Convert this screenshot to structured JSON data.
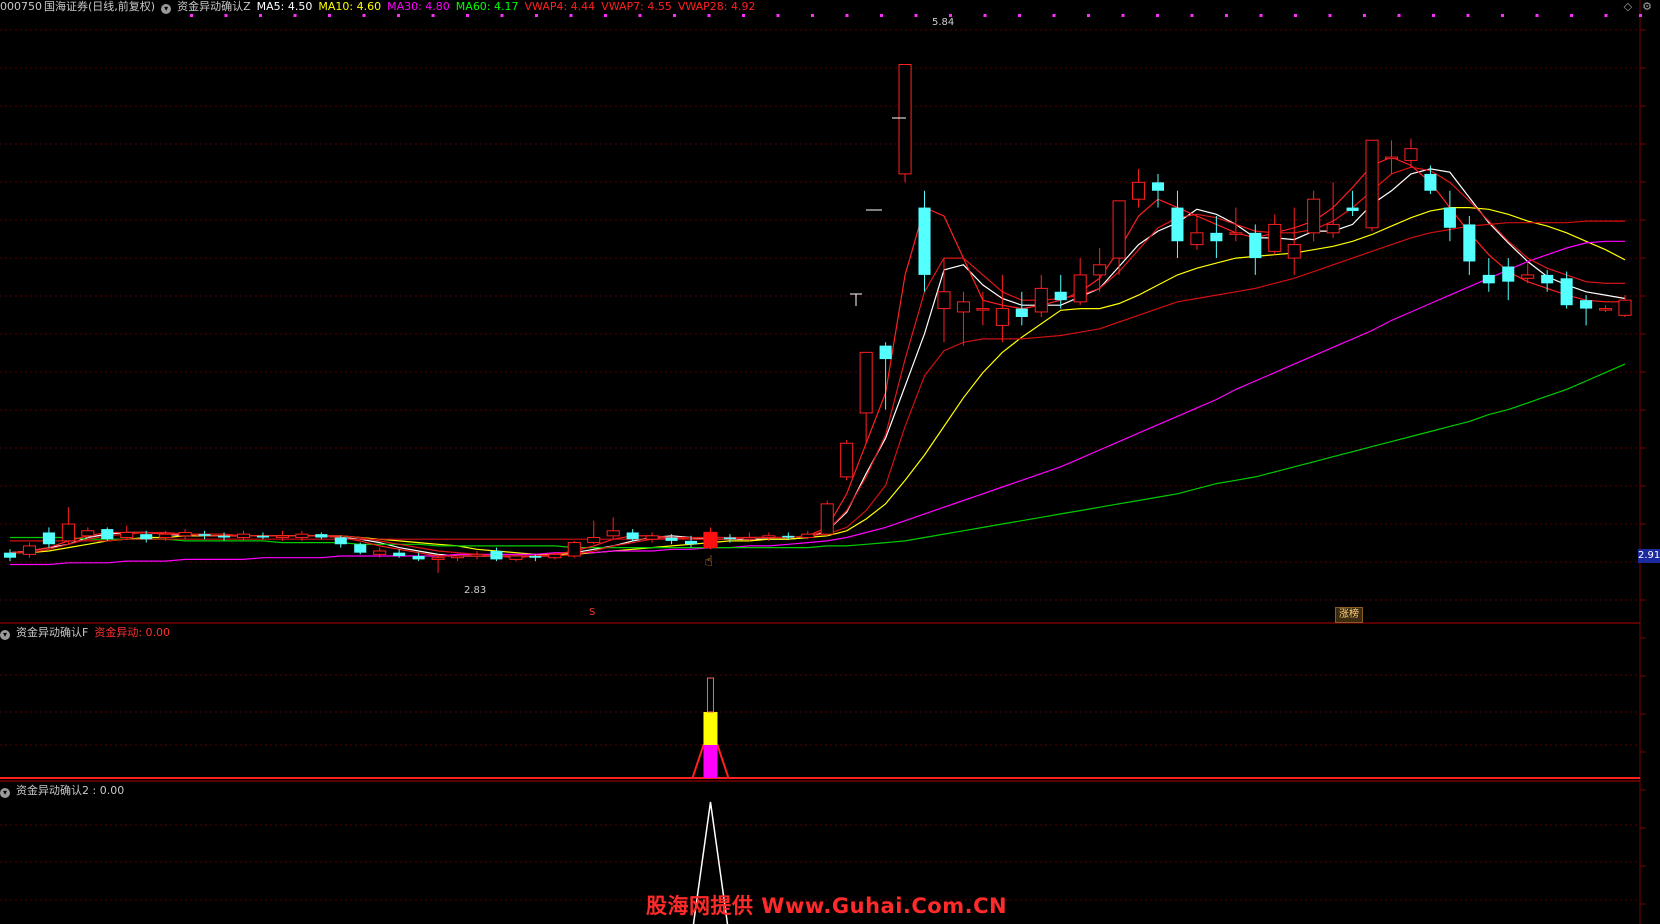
{
  "header_main": {
    "symbol": "000750",
    "name": "国海证券(日线,前复权)",
    "indicator": "资金异动确认Z",
    "ma": [
      {
        "label": "MA5: 4.50",
        "color": "#ffffff"
      },
      {
        "label": "MA10: 4.60",
        "color": "#ffff00"
      },
      {
        "label": "MA30: 4.80",
        "color": "#ff00ff"
      },
      {
        "label": "MA60: 4.17",
        "color": "#00ff00"
      },
      {
        "label": "VWAP4: 4.44",
        "color": "#ff2020"
      },
      {
        "label": "VWAP7: 4.55",
        "color": "#ff2020"
      },
      {
        "label": "VWAP28: 4.92",
        "color": "#ff2020"
      }
    ]
  },
  "header_panel2": {
    "name": "资金异动确认F",
    "value": "资金异动: 0.00"
  },
  "header_panel3": {
    "name": "资金异动确认2 : 0.00"
  },
  "labels": {
    "high": "5.84",
    "low": "2.83",
    "last_price": "2.91",
    "badge": "涨榜",
    "s_mark": "S"
  },
  "watermark": "股海网提供 Www.Guhai.Com.CN",
  "icons": [
    "diamond-icon",
    "settings-icon"
  ],
  "colors": {
    "up": "#ff2020",
    "down": "#54ffff",
    "ma5": "#ffffff",
    "ma10": "#ffff00",
    "ma30": "#ff00ff",
    "ma60": "#00cc00",
    "grid": "#5a0000"
  },
  "chart_data": {
    "type": "candlestick",
    "y_range": [
      2.55,
      6.15
    ],
    "candles": [
      [
        2.95,
        2.92,
        2.97,
        2.9
      ],
      [
        2.94,
        2.99,
        3.01,
        2.92
      ],
      [
        3.07,
        3.0,
        3.1,
        2.98
      ],
      [
        3.02,
        3.12,
        3.22,
        3.0
      ],
      [
        3.05,
        3.08,
        3.1,
        3.03
      ],
      [
        3.09,
        3.03,
        3.1,
        3.02
      ],
      [
        3.04,
        3.07,
        3.11,
        3.03
      ],
      [
        3.06,
        3.03,
        3.08,
        3.01
      ],
      [
        3.04,
        3.06,
        3.08,
        3.02
      ],
      [
        3.05,
        3.07,
        3.09,
        3.03
      ],
      [
        3.06,
        3.05,
        3.08,
        3.03
      ],
      [
        3.05,
        3.04,
        3.07,
        3.02
      ],
      [
        3.04,
        3.06,
        3.08,
        3.02
      ],
      [
        3.05,
        3.04,
        3.07,
        3.03
      ],
      [
        3.04,
        3.05,
        3.08,
        3.02
      ],
      [
        3.04,
        3.06,
        3.08,
        3.02
      ],
      [
        3.06,
        3.04,
        3.07,
        3.03
      ],
      [
        3.04,
        3.0,
        3.05,
        2.98
      ],
      [
        3.0,
        2.95,
        3.01,
        2.94
      ],
      [
        2.94,
        2.96,
        2.98,
        2.92
      ],
      [
        2.95,
        2.93,
        2.97,
        2.92
      ],
      [
        2.93,
        2.91,
        2.95,
        2.9
      ],
      [
        2.91,
        2.92,
        2.94,
        2.83
      ],
      [
        2.92,
        2.93,
        2.94,
        2.9
      ],
      [
        2.93,
        2.94,
        2.96,
        2.91
      ],
      [
        2.96,
        2.91,
        2.98,
        2.9
      ],
      [
        2.91,
        2.93,
        2.94,
        2.9
      ],
      [
        2.93,
        2.92,
        2.94,
        2.9
      ],
      [
        2.92,
        2.94,
        2.95,
        2.91
      ],
      [
        2.93,
        3.01,
        3.02,
        2.92
      ],
      [
        3.01,
        3.04,
        3.14,
        3.0
      ],
      [
        3.05,
        3.08,
        3.16,
        3.03
      ],
      [
        3.07,
        3.03,
        3.09,
        3.02
      ],
      [
        3.03,
        3.05,
        3.07,
        3.01
      ],
      [
        3.04,
        3.02,
        3.06,
        3.0
      ],
      [
        3.02,
        3.0,
        3.05,
        2.98
      ],
      [
        2.98,
        3.04,
        3.1,
        2.97
      ],
      [
        3.04,
        3.03,
        3.06,
        3.01
      ],
      [
        3.03,
        3.04,
        3.07,
        3.02
      ],
      [
        3.04,
        3.05,
        3.07,
        3.02
      ],
      [
        3.05,
        3.04,
        3.07,
        3.03
      ],
      [
        3.04,
        3.06,
        3.08,
        3.03
      ],
      [
        3.06,
        3.24,
        3.26,
        3.05
      ],
      [
        3.4,
        3.6,
        3.62,
        3.38
      ],
      [
        3.78,
        4.14,
        4.14,
        3.6
      ],
      [
        4.18,
        4.1,
        4.2,
        3.8
      ],
      [
        5.2,
        5.85,
        5.85,
        5.15
      ],
      [
        5.0,
        4.6,
        5.1,
        4.5
      ],
      [
        4.4,
        4.5,
        4.7,
        4.2
      ],
      [
        4.38,
        4.44,
        4.5,
        4.18
      ],
      [
        4.4,
        4.4,
        4.5,
        4.3
      ],
      [
        4.3,
        4.4,
        4.6,
        4.2
      ],
      [
        4.4,
        4.35,
        4.5,
        4.3
      ],
      [
        4.38,
        4.52,
        4.6,
        4.35
      ],
      [
        4.5,
        4.45,
        4.6,
        4.4
      ],
      [
        4.44,
        4.6,
        4.7,
        4.42
      ],
      [
        4.6,
        4.66,
        4.76,
        4.5
      ],
      [
        4.7,
        5.04,
        5.04,
        4.6
      ],
      [
        5.05,
        5.15,
        5.23,
        5.0
      ],
      [
        5.15,
        5.1,
        5.2,
        5.0
      ],
      [
        5.0,
        4.8,
        5.1,
        4.7
      ],
      [
        4.78,
        4.85,
        4.95,
        4.75
      ],
      [
        4.85,
        4.8,
        4.95,
        4.7
      ],
      [
        4.85,
        4.85,
        5.0,
        4.8
      ],
      [
        4.85,
        4.7,
        4.9,
        4.6
      ],
      [
        4.74,
        4.9,
        4.96,
        4.72
      ],
      [
        4.7,
        4.78,
        5.0,
        4.6
      ],
      [
        4.85,
        5.05,
        5.1,
        4.8
      ],
      [
        4.85,
        4.9,
        5.15,
        4.82
      ],
      [
        5.0,
        4.98,
        5.1,
        4.95
      ],
      [
        4.88,
        5.4,
        5.4,
        4.86
      ],
      [
        5.3,
        5.3,
        5.4,
        5.2
      ],
      [
        5.28,
        5.35,
        5.41,
        5.24
      ],
      [
        5.2,
        5.1,
        5.25,
        5.08
      ],
      [
        5.0,
        4.88,
        5.1,
        4.8
      ],
      [
        4.9,
        4.68,
        4.95,
        4.6
      ],
      [
        4.6,
        4.55,
        4.7,
        4.5
      ],
      [
        4.65,
        4.56,
        4.7,
        4.45
      ],
      [
        4.58,
        4.6,
        4.68,
        4.55
      ],
      [
        4.6,
        4.55,
        4.63,
        4.5
      ],
      [
        4.58,
        4.42,
        4.62,
        4.4
      ],
      [
        4.45,
        4.4,
        4.48,
        4.3
      ],
      [
        4.4,
        4.4,
        4.42,
        4.38
      ],
      [
        4.36,
        4.45,
        4.48,
        4.35
      ]
    ],
    "series": [
      {
        "name": "MA5",
        "values": [
          2.95,
          2.96,
          2.98,
          3.0,
          3.04,
          3.06,
          3.07,
          3.07,
          3.06,
          3.05,
          3.05,
          3.05,
          3.05,
          3.05,
          3.05,
          3.05,
          3.05,
          3.04,
          3.03,
          3.01,
          2.98,
          2.96,
          2.94,
          2.93,
          2.93,
          2.93,
          2.93,
          2.93,
          2.93,
          2.95,
          2.97,
          2.99,
          3.02,
          3.04,
          3.05,
          3.04,
          3.03,
          3.03,
          3.03,
          3.03,
          3.03,
          3.04,
          3.08,
          3.19,
          3.42,
          3.63,
          3.94,
          4.25,
          4.63,
          4.66,
          4.54,
          4.46,
          4.42,
          4.42,
          4.42,
          4.47,
          4.52,
          4.65,
          4.78,
          4.86,
          4.91,
          4.99,
          4.96,
          4.9,
          4.82,
          4.82,
          4.81,
          4.86,
          4.86,
          4.9,
          5.02,
          5.1,
          5.2,
          5.23,
          5.21,
          5.06,
          4.91,
          4.79,
          4.68,
          4.59,
          4.54,
          4.5,
          4.48,
          4.46
        ]
      },
      {
        "name": "MA10",
        "values": [
          2.95,
          2.95,
          2.96,
          2.98,
          3.0,
          3.02,
          3.03,
          3.04,
          3.04,
          3.05,
          3.05,
          3.05,
          3.05,
          3.05,
          3.05,
          3.05,
          3.05,
          3.05,
          3.04,
          3.03,
          3.02,
          3.01,
          3.0,
          2.99,
          2.97,
          2.96,
          2.95,
          2.94,
          2.94,
          2.94,
          2.95,
          2.96,
          2.97,
          2.98,
          2.99,
          3.0,
          3.01,
          3.02,
          3.02,
          3.03,
          3.03,
          3.04,
          3.05,
          3.08,
          3.15,
          3.24,
          3.38,
          3.53,
          3.7,
          3.87,
          4.02,
          4.14,
          4.23,
          4.31,
          4.39,
          4.4,
          4.4,
          4.43,
          4.48,
          4.54,
          4.6,
          4.64,
          4.67,
          4.7,
          4.71,
          4.72,
          4.73,
          4.75,
          4.77,
          4.8,
          4.84,
          4.89,
          4.94,
          4.98,
          5.0,
          5.0,
          4.99,
          4.96,
          4.92,
          4.89,
          4.85,
          4.8,
          4.75,
          4.69
        ]
      },
      {
        "name": "MA30",
        "values": [
          2.88,
          2.88,
          2.88,
          2.89,
          2.89,
          2.89,
          2.9,
          2.9,
          2.9,
          2.91,
          2.91,
          2.91,
          2.91,
          2.92,
          2.92,
          2.92,
          2.92,
          2.93,
          2.93,
          2.93,
          2.93,
          2.93,
          2.93,
          2.94,
          2.94,
          2.94,
          2.94,
          2.94,
          2.95,
          2.95,
          2.95,
          2.96,
          2.96,
          2.96,
          2.97,
          2.97,
          2.98,
          2.98,
          2.99,
          2.99,
          3.0,
          3.01,
          3.02,
          3.04,
          3.07,
          3.1,
          3.14,
          3.18,
          3.22,
          3.26,
          3.3,
          3.34,
          3.38,
          3.42,
          3.46,
          3.51,
          3.56,
          3.61,
          3.66,
          3.71,
          3.76,
          3.81,
          3.86,
          3.92,
          3.97,
          4.02,
          4.07,
          4.12,
          4.17,
          4.22,
          4.27,
          4.33,
          4.38,
          4.43,
          4.48,
          4.53,
          4.58,
          4.63,
          4.68,
          4.72,
          4.76,
          4.79,
          4.8,
          4.8
        ]
      },
      {
        "name": "MA60",
        "values": [
          3.04,
          3.04,
          3.04,
          3.04,
          3.03,
          3.03,
          3.03,
          3.03,
          3.03,
          3.02,
          3.02,
          3.02,
          3.02,
          3.02,
          3.01,
          3.01,
          3.01,
          3.01,
          3.0,
          3.0,
          3.0,
          3.0,
          2.99,
          2.99,
          2.99,
          2.99,
          2.99,
          2.99,
          2.99,
          2.98,
          2.98,
          2.98,
          2.98,
          2.98,
          2.98,
          2.98,
          2.98,
          2.98,
          2.98,
          2.98,
          2.98,
          2.98,
          2.99,
          2.99,
          3.0,
          3.01,
          3.02,
          3.04,
          3.06,
          3.08,
          3.1,
          3.12,
          3.14,
          3.16,
          3.18,
          3.2,
          3.22,
          3.24,
          3.26,
          3.28,
          3.3,
          3.33,
          3.36,
          3.38,
          3.4,
          3.43,
          3.46,
          3.49,
          3.52,
          3.55,
          3.58,
          3.61,
          3.64,
          3.67,
          3.7,
          3.73,
          3.77,
          3.8,
          3.84,
          3.88,
          3.92,
          3.97,
          4.02,
          4.07
        ]
      },
      {
        "name": "VWAP4",
        "values": [
          2.95,
          2.96,
          2.98,
          3.02,
          3.05,
          3.07,
          3.07,
          3.07,
          3.06,
          3.06,
          3.05,
          3.05,
          3.05,
          3.05,
          3.05,
          3.05,
          3.05,
          3.04,
          3.02,
          2.99,
          2.97,
          2.95,
          2.93,
          2.93,
          2.93,
          2.93,
          2.92,
          2.93,
          2.94,
          2.96,
          2.99,
          3.03,
          3.05,
          3.05,
          3.04,
          3.03,
          3.03,
          3.03,
          3.04,
          3.04,
          3.04,
          3.05,
          3.1,
          3.3,
          3.6,
          3.9,
          4.6,
          5.0,
          4.95,
          4.7,
          4.45,
          4.42,
          4.4,
          4.42,
          4.45,
          4.5,
          4.58,
          4.75,
          4.95,
          5.05,
          5.0,
          4.95,
          4.9,
          4.85,
          4.82,
          4.85,
          4.88,
          4.92,
          5.0,
          5.12,
          5.25,
          5.3,
          5.25,
          5.15,
          5.0,
          4.85,
          4.72,
          4.62,
          4.56,
          4.52,
          4.48,
          4.45,
          4.44,
          4.44
        ]
      },
      {
        "name": "VWAP7",
        "values": [
          2.95,
          2.95,
          2.97,
          3.0,
          3.03,
          3.05,
          3.06,
          3.07,
          3.07,
          3.06,
          3.06,
          3.06,
          3.05,
          3.05,
          3.05,
          3.05,
          3.05,
          3.05,
          3.04,
          3.02,
          3.0,
          2.98,
          2.96,
          2.95,
          2.94,
          2.93,
          2.93,
          2.93,
          2.93,
          2.94,
          2.96,
          2.99,
          3.01,
          3.03,
          3.04,
          3.04,
          3.04,
          3.04,
          3.04,
          3.04,
          3.04,
          3.05,
          3.08,
          3.2,
          3.4,
          3.65,
          4.1,
          4.5,
          4.7,
          4.7,
          4.6,
          4.5,
          4.45,
          4.45,
          4.46,
          4.48,
          4.52,
          4.62,
          4.75,
          4.88,
          4.94,
          4.96,
          4.94,
          4.9,
          4.86,
          4.85,
          4.85,
          4.87,
          4.92,
          5.0,
          5.1,
          5.2,
          5.24,
          5.22,
          5.15,
          5.04,
          4.92,
          4.8,
          4.7,
          4.64,
          4.6,
          4.56,
          4.55,
          4.55
        ]
      },
      {
        "name": "VWAP28",
        "values": [
          3.02,
          3.02,
          3.02,
          3.02,
          3.02,
          3.02,
          3.03,
          3.03,
          3.03,
          3.03,
          3.03,
          3.03,
          3.03,
          3.03,
          3.03,
          3.03,
          3.03,
          3.03,
          3.03,
          3.03,
          3.03,
          3.03,
          3.03,
          3.03,
          3.03,
          3.03,
          3.03,
          3.03,
          3.03,
          3.03,
          3.03,
          3.03,
          3.03,
          3.03,
          3.03,
          3.03,
          3.03,
          3.03,
          3.04,
          3.04,
          3.04,
          3.05,
          3.06,
          3.1,
          3.2,
          3.35,
          3.7,
          4.0,
          4.15,
          4.2,
          4.22,
          4.22,
          4.22,
          4.23,
          4.24,
          4.26,
          4.28,
          4.32,
          4.36,
          4.4,
          4.44,
          4.46,
          4.48,
          4.5,
          4.52,
          4.55,
          4.58,
          4.62,
          4.66,
          4.7,
          4.74,
          4.78,
          4.82,
          4.85,
          4.87,
          4.89,
          4.9,
          4.91,
          4.91,
          4.91,
          4.91,
          4.92,
          4.92,
          4.92
        ]
      }
    ],
    "indicator_f": {
      "signal_index": 36,
      "value": "0.00"
    },
    "indicator_2": {
      "signal_index": 36,
      "value": "0.00"
    }
  }
}
